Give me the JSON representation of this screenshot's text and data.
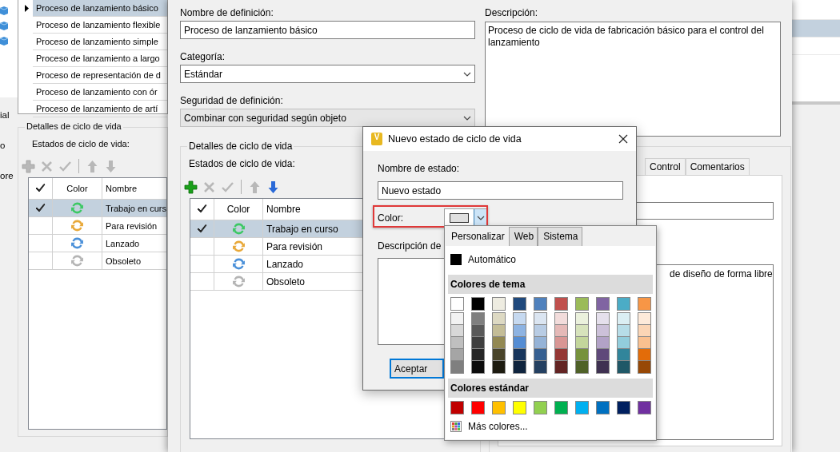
{
  "back_window": {
    "side_fragments": [
      "ial",
      "o",
      "ore"
    ],
    "definitions": [
      {
        "name": "Proceso de lanzamiento básico",
        "selected": true
      },
      {
        "name": "Proceso de lanzamiento flexible",
        "selected": false
      },
      {
        "name": "Proceso de lanzamiento simple",
        "selected": false
      },
      {
        "name": "Proceso de lanzamiento a largo",
        "selected": false
      },
      {
        "name": "Proceso de representación de d",
        "selected": false
      },
      {
        "name": "Proceso de lanzamiento con ór",
        "selected": false
      },
      {
        "name": "Proceso de lanzamiento de artí",
        "selected": false
      }
    ],
    "lifecycle": {
      "title": "Detalles de ciclo de vida",
      "states_label": "Estados de ciclo de vida:",
      "tools": [
        {
          "kind": "add",
          "disabled": true
        },
        {
          "kind": "delete",
          "disabled": true
        },
        {
          "kind": "check",
          "disabled": true
        },
        {
          "kind": "up",
          "disabled": true
        },
        {
          "kind": "down",
          "disabled": true
        }
      ],
      "columns": [
        "Color",
        "Nombre"
      ],
      "rows": [
        {
          "default": true,
          "selected": true,
          "color": "#3cc864",
          "name": "Trabajo en curs"
        },
        {
          "default": false,
          "selected": false,
          "color": "#e8a838",
          "name": "Para revisión"
        },
        {
          "default": false,
          "selected": false,
          "color": "#4a90d9",
          "name": "Lanzado"
        },
        {
          "default": false,
          "selected": false,
          "color": "#b4b4b4",
          "name": "Obsoleto"
        }
      ]
    },
    "right_rows": [
      {
        "selected": false
      },
      {
        "selected": true
      },
      {
        "selected": false
      }
    ]
  },
  "definition_window": {
    "name_label": "Nombre de definición:",
    "name_value": "Proceso de lanzamiento básico",
    "category": {
      "label": "Categoría:",
      "value": "Estándar",
      "disabled": false
    },
    "security": {
      "label": "Seguridad de definición:",
      "value": "Combinar con seguridad según objeto",
      "disabled": true
    },
    "description_label": "Descripción:",
    "description": "Proceso de ciclo de vida de fabricación básico para el control del lanzamiento",
    "lifecycle": {
      "title": "Detalles de ciclo de vida",
      "states_label": "Estados de ciclo de vida:",
      "tools": [
        {
          "kind": "add",
          "disabled": false
        },
        {
          "kind": "delete",
          "disabled": true
        },
        {
          "kind": "check",
          "disabled": true
        },
        {
          "kind": "up",
          "disabled": true
        },
        {
          "kind": "down",
          "disabled": false
        }
      ],
      "columns": [
        "Color",
        "Nombre"
      ],
      "rows": [
        {
          "default": true,
          "selected": true,
          "color": "#3cc864",
          "name": "Trabajo en curso"
        },
        {
          "default": false,
          "selected": false,
          "color": "#e8a838",
          "name": "Para revisión"
        },
        {
          "default": false,
          "selected": false,
          "color": "#4a90d9",
          "name": "Lanzado"
        },
        {
          "default": false,
          "selected": false,
          "color": "#b4b4b4",
          "name": "Obsoleto"
        }
      ]
    },
    "tabs": [
      {
        "label": "Control",
        "selected": false
      },
      {
        "label": "Comentarios",
        "selected": false
      }
    ],
    "tab_text": "de diseño de forma libre"
  },
  "dialog": {
    "icon_letter": "V",
    "title": "Nuevo estado de ciclo de vida",
    "name_label": "Nombre de estado:",
    "name_value": "Nuevo estado",
    "color_field": {
      "label": "Color:",
      "color": "#e0e0e0",
      "expanded": true,
      "highlighted": true
    },
    "description_label": "Descripción de",
    "ok_button": "Aceptar"
  },
  "color_popup": {
    "tabs": [
      {
        "label": "Personalizar",
        "selected": true
      },
      {
        "label": "Web",
        "selected": false
      },
      {
        "label": "Sistema",
        "selected": false
      }
    ],
    "automatic": {
      "label": "Automático",
      "color": "#000000"
    },
    "theme_header": "Colores de tema",
    "theme_colors": [
      {
        "color": "#ffffff",
        "shades": [
          {
            "color": "#f2f2f2"
          },
          {
            "color": "#d8d8d8"
          },
          {
            "color": "#bfbfbf"
          },
          {
            "color": "#a5a5a5"
          },
          {
            "color": "#7f7f7f"
          }
        ]
      },
      {
        "color": "#000000",
        "shades": [
          {
            "color": "#7f7f7f"
          },
          {
            "color": "#595959"
          },
          {
            "color": "#3f3f3f"
          },
          {
            "color": "#262626"
          },
          {
            "color": "#0c0c0c"
          }
        ]
      },
      {
        "color": "#eeece1",
        "shades": [
          {
            "color": "#ddd9c3"
          },
          {
            "color": "#c4bd97"
          },
          {
            "color": "#938953"
          },
          {
            "color": "#494429"
          },
          {
            "color": "#1d1b10"
          }
        ]
      },
      {
        "color": "#1f497d",
        "shades": [
          {
            "color": "#c6d9f0"
          },
          {
            "color": "#8db3e2"
          },
          {
            "color": "#548dd4"
          },
          {
            "color": "#17365d"
          },
          {
            "color": "#0f243e"
          }
        ]
      },
      {
        "color": "#4f81bd",
        "shades": [
          {
            "color": "#dbe5f1"
          },
          {
            "color": "#b8cce4"
          },
          {
            "color": "#95b3d7"
          },
          {
            "color": "#366092"
          },
          {
            "color": "#244061"
          }
        ]
      },
      {
        "color": "#c0504d",
        "shades": [
          {
            "color": "#f2dcdb"
          },
          {
            "color": "#e5b9b7"
          },
          {
            "color": "#d99694"
          },
          {
            "color": "#953734"
          },
          {
            "color": "#632423"
          }
        ]
      },
      {
        "color": "#9bbb59",
        "shades": [
          {
            "color": "#ebf1dd"
          },
          {
            "color": "#d7e3bc"
          },
          {
            "color": "#c3d69b"
          },
          {
            "color": "#76923c"
          },
          {
            "color": "#4f6128"
          }
        ]
      },
      {
        "color": "#8064a2",
        "shades": [
          {
            "color": "#e5e0ec"
          },
          {
            "color": "#ccc1d9"
          },
          {
            "color": "#b2a2c7"
          },
          {
            "color": "#5f497a"
          },
          {
            "color": "#3f3151"
          }
        ]
      },
      {
        "color": "#4bacc6",
        "shades": [
          {
            "color": "#dbeef3"
          },
          {
            "color": "#b7dde8"
          },
          {
            "color": "#92cddc"
          },
          {
            "color": "#31859b"
          },
          {
            "color": "#205867"
          }
        ]
      },
      {
        "color": "#f79646",
        "shades": [
          {
            "color": "#fdeada"
          },
          {
            "color": "#fbd5b5"
          },
          {
            "color": "#fac08f"
          },
          {
            "color": "#e36c09"
          },
          {
            "color": "#974806"
          }
        ]
      }
    ],
    "standard_header": "Colores estándar",
    "standard_colors": [
      {
        "color": "#c00000"
      },
      {
        "color": "#ff0000"
      },
      {
        "color": "#ffc000"
      },
      {
        "color": "#ffff00"
      },
      {
        "color": "#92d050"
      },
      {
        "color": "#00b050"
      },
      {
        "color": "#00b0f0"
      },
      {
        "color": "#0070c0"
      },
      {
        "color": "#002060"
      },
      {
        "color": "#7030a0"
      }
    ],
    "more_colors": "Más colores..."
  }
}
